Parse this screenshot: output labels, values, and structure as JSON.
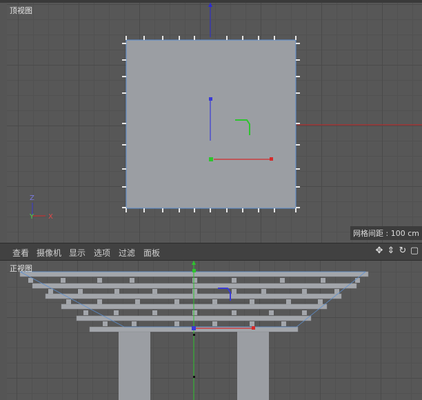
{
  "top_view": {
    "label": "顶视图",
    "grid_spacing": "网格间距 : 100 cm",
    "axis_labels": {
      "z": "Z",
      "y": "Y",
      "x": "X"
    }
  },
  "menu": {
    "items": [
      "查看",
      "摄像机",
      "显示",
      "选项",
      "过滤",
      "面板"
    ]
  },
  "front_view": {
    "label": "正视图"
  },
  "colors": {
    "viewport_bg": "#575757",
    "plane_fill": "#9b9ea3",
    "selection_blue": "#4a8bd6",
    "axis_x": "#d42b2b",
    "axis_y": "#2ec42e",
    "axis_z": "#3a3ad6"
  }
}
